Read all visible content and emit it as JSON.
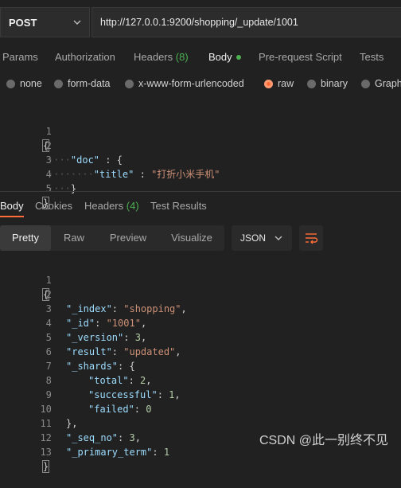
{
  "request": {
    "method": "POST",
    "url": "http://127.0.0.1:9200/shopping/_update/1001"
  },
  "request_tabs": [
    {
      "label": "Params"
    },
    {
      "label": "Authorization"
    },
    {
      "label": "Headers",
      "count": "(8)"
    },
    {
      "label": "Body"
    },
    {
      "label": "Pre-request Script"
    },
    {
      "label": "Tests"
    }
  ],
  "body_types": [
    "none",
    "form-data",
    "x-www-form-urlencoded",
    "raw",
    "binary",
    "Graph"
  ],
  "body_type_selected": "raw",
  "request_body": {
    "line_numbers": [
      "1",
      "2",
      "3",
      "4",
      "5"
    ],
    "open_brace": "{",
    "doc_key": "\"doc\"",
    "colon": ":",
    "inner_open": "{",
    "title_key": "\"title\"",
    "title_value": "\"打折小米手机\"",
    "inner_close": "}",
    "close_brace": "}"
  },
  "response_tabs": [
    {
      "label": "Body"
    },
    {
      "label": "Cookies"
    },
    {
      "label": "Headers",
      "count": "(4)"
    },
    {
      "label": "Test Results"
    }
  ],
  "view_modes": [
    "Pretty",
    "Raw",
    "Preview",
    "Visualize"
  ],
  "view_mode_selected": "Pretty",
  "format": "JSON",
  "response_body": {
    "line_numbers": [
      "1",
      "2",
      "3",
      "4",
      "5",
      "6",
      "7",
      "8",
      "9",
      "10",
      "11",
      "12",
      "13"
    ],
    "open_brace": "{",
    "index_key": "\"_index\"",
    "index_value": "\"shopping\"",
    "id_key": "\"_id\"",
    "id_value": "\"1001\"",
    "version_key": "\"_version\"",
    "version_value": "3",
    "result_key": "\"result\"",
    "result_value": "\"updated\"",
    "shards_key": "\"_shards\"",
    "shards_open": "{",
    "total_key": "\"total\"",
    "total_value": "2",
    "successful_key": "\"successful\"",
    "successful_value": "1",
    "failed_key": "\"failed\"",
    "failed_value": "0",
    "shards_close": "},",
    "seq_no_key": "\"_seq_no\"",
    "seq_no_value": "3",
    "primary_term_key": "\"_primary_term\"",
    "primary_term_value": "1",
    "close_brace": "}"
  },
  "icons": {
    "method_dropdown": "chevron-down-icon",
    "format_dropdown": "chevron-down-icon",
    "wrap": "wrap-lines-icon"
  },
  "colors": {
    "accent": "#ff6c37",
    "count_green": "#4caf50",
    "json_key": "#9cdcfe",
    "json_string": "#ce9178",
    "json_number": "#b5cea8"
  },
  "watermark": "CSDN @此一别终不见"
}
